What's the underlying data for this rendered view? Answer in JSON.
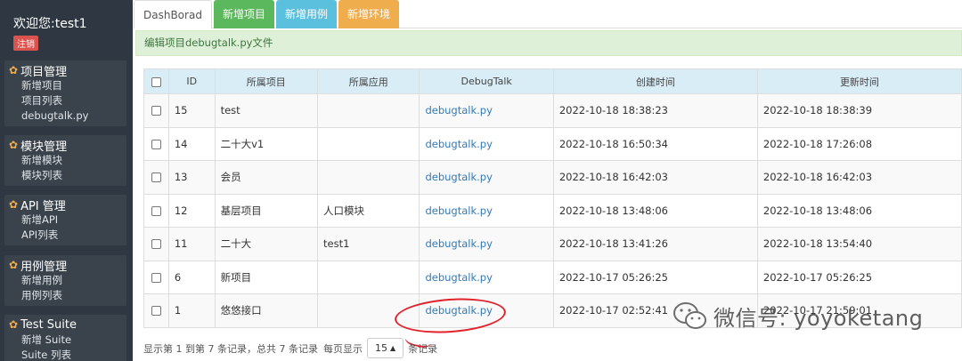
{
  "sidebar": {
    "welcome": "欢迎您:test1",
    "logout": "注销",
    "groups": [
      {
        "title": "项目管理",
        "items": [
          "新增项目",
          "项目列表",
          "debugtalk.py"
        ]
      },
      {
        "title": "模块管理",
        "items": [
          "新增模块",
          "模块列表"
        ]
      },
      {
        "title": "API 管理",
        "items": [
          "新增API",
          "API列表"
        ]
      },
      {
        "title": "用例管理",
        "items": [
          "新增用例",
          "用例列表"
        ]
      },
      {
        "title": "Test Suite",
        "items": [
          "新增 Suite",
          "Suite 列表"
        ]
      }
    ]
  },
  "tabs": [
    "DashBorad",
    "新增项目",
    "新增用例",
    "新增环境"
  ],
  "alert": "编辑项目debugtalk.py文件",
  "table": {
    "headers": [
      "ID",
      "所属项目",
      "所属应用",
      "DebugTalk",
      "创建时间",
      "更新时间"
    ],
    "rows": [
      {
        "id": "15",
        "project": "test",
        "app": "",
        "debugtalk": "debugtalk.py",
        "created": "2022-10-18 18:38:23",
        "updated": "2022-10-18 18:38:39"
      },
      {
        "id": "14",
        "project": "二十大v1",
        "app": "",
        "debugtalk": "debugtalk.py",
        "created": "2022-10-18 16:50:34",
        "updated": "2022-10-18 17:26:08"
      },
      {
        "id": "13",
        "project": "会员",
        "app": "",
        "debugtalk": "debugtalk.py",
        "created": "2022-10-18 16:42:03",
        "updated": "2022-10-18 16:42:03"
      },
      {
        "id": "12",
        "project": "基层项目",
        "app": "人口模块",
        "debugtalk": "debugtalk.py",
        "created": "2022-10-18 13:48:06",
        "updated": "2022-10-18 13:48:06"
      },
      {
        "id": "11",
        "project": "二十大",
        "app": "test1",
        "debugtalk": "debugtalk.py",
        "created": "2022-10-18 13:41:26",
        "updated": "2022-10-18 13:54:40"
      },
      {
        "id": "6",
        "project": "新项目",
        "app": "",
        "debugtalk": "debugtalk.py",
        "created": "2022-10-17 05:26:25",
        "updated": "2022-10-17 05:26:25"
      },
      {
        "id": "1",
        "project": "悠悠接口",
        "app": "",
        "debugtalk": "debugtalk.py",
        "created": "2022-10-17 02:52:41",
        "updated": "2022-10-17 21:59:01"
      }
    ]
  },
  "footer": {
    "summary": "显示第 1 到第 7 条记录，总共 7 条记录",
    "per_page_label": "每页显示",
    "page_size": "15",
    "per_page_suffix": "条记录"
  },
  "watermark": "微信号: yoyoketang"
}
